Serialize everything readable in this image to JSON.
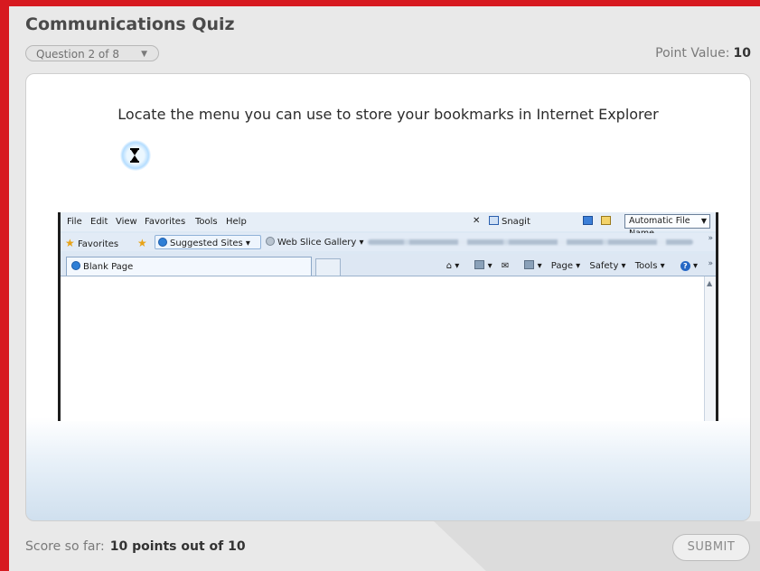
{
  "quiz": {
    "title": "Communications Quiz",
    "question_select": "Question 2 of 8",
    "point_value_label": "Point Value:",
    "point_value": "10",
    "prompt": "Locate the menu you can use to store your bookmarks in Internet Explorer"
  },
  "ie": {
    "menu": [
      "File",
      "Edit",
      "View",
      "Favorites",
      "Tools",
      "Help"
    ],
    "snagit_label": "Snagit",
    "dropdown_value": "Automatic File Name",
    "favorites_label": "Favorites",
    "suggested_sites_label": "Suggested Sites ▾",
    "web_slice_label": "Web Slice Gallery ▾",
    "tab_title": "Blank Page",
    "cmd_page": "Page ▾",
    "cmd_safety": "Safety ▾",
    "cmd_tools": "Tools ▾"
  },
  "footer": {
    "score_label": "Score so far:",
    "score_value": "10 points out of 10",
    "submit_label": "SUBMIT"
  },
  "colors": {
    "frame": "#d71920",
    "background": "#e9e9e9",
    "card": "#ffffff"
  }
}
